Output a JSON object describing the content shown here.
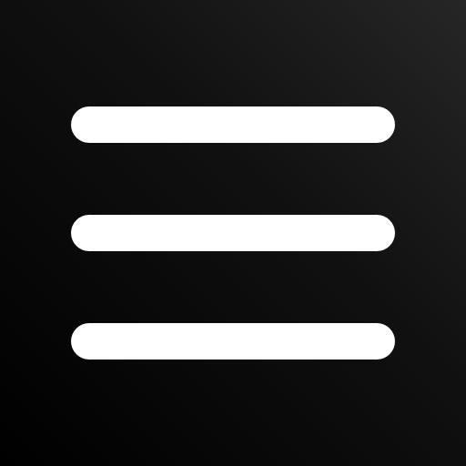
{
  "icon": {
    "name": "hamburger-menu-icon",
    "line_count": 3
  },
  "colors": {
    "background_dark": "#000000",
    "background_light": "#262626",
    "foreground": "#ffffff"
  }
}
